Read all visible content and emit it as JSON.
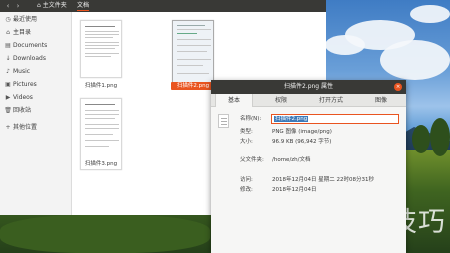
{
  "header": {
    "breadcrumb_home": "主文件夹",
    "breadcrumb_current": "文档"
  },
  "sidebar": {
    "items": [
      {
        "icon": "clock-icon",
        "label": "最近使用"
      },
      {
        "icon": "home-icon",
        "label": "主目录"
      },
      {
        "icon": "documents-icon",
        "label": "Documents"
      },
      {
        "icon": "downloads-icon",
        "label": "Downloads"
      },
      {
        "icon": "music-icon",
        "label": "Music"
      },
      {
        "icon": "pictures-icon",
        "label": "Pictures"
      },
      {
        "icon": "videos-icon",
        "label": "Videos"
      },
      {
        "icon": "trash-icon",
        "label": "回收站"
      },
      {
        "icon": "plus-icon",
        "label": "其他位置"
      }
    ]
  },
  "files": [
    {
      "name": "扫描件1.png",
      "selected": false
    },
    {
      "name": "扫描件2.png",
      "selected": true
    },
    {
      "name": "扫描件3.png",
      "selected": false
    }
  ],
  "dialog": {
    "title": "扫描件2.png 属性",
    "close": "×",
    "tabs": [
      "基本",
      "权限",
      "打开方式",
      "图像"
    ],
    "active_tab": "基本",
    "name_label": "名称(N):",
    "name_value": "扫描件2.png",
    "type_label": "类型:",
    "type_value": "PNG 图像 (image/png)",
    "size_label": "大小:",
    "size_value": "96.9 KB (96,942 字节)",
    "parent_label": "父文件夹:",
    "parent_value": "/home/zh/文档",
    "accessed_label": "访问:",
    "accessed_value": "2018年12月04日 星期二 22时08分31秒",
    "modified_label": "修改:",
    "modified_value": "2018年12月04日"
  },
  "watermark": "软件技巧",
  "colors": {
    "accent": "#e95420",
    "titlebar": "#393936",
    "selection": "#3d7ab8"
  }
}
